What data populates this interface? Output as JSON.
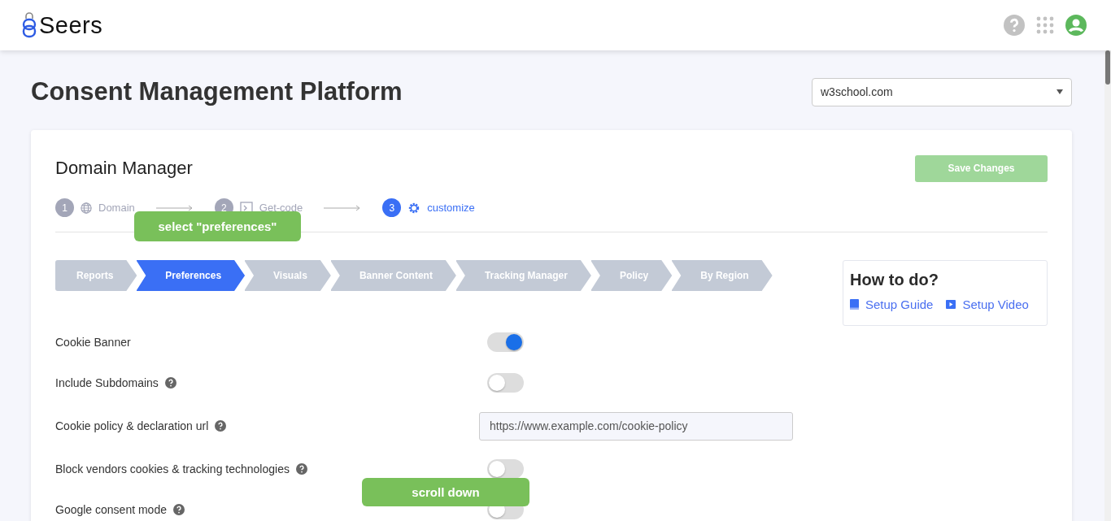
{
  "header": {
    "logo_text": "Seers"
  },
  "page_title": "Consent Management Platform",
  "domain_select": {
    "value": "w3school.com"
  },
  "card": {
    "title": "Domain Manager",
    "save_button": {
      "label": "Save Changes",
      "disabled": true
    },
    "steps": [
      {
        "number": "1",
        "label": "Domain",
        "selected": false
      },
      {
        "number": "2",
        "label": "Get-code",
        "selected": false
      },
      {
        "number": "3",
        "label": "customize",
        "selected": true
      }
    ],
    "tabs": [
      {
        "label": "Reports",
        "selected": false
      },
      {
        "label": "Preferences",
        "selected": true
      },
      {
        "label": "Visuals",
        "selected": false
      },
      {
        "label": "Banner Content",
        "selected": false
      },
      {
        "label": "Tracking Manager",
        "selected": false
      },
      {
        "label": "Policy",
        "selected": false
      },
      {
        "label": "By Region",
        "selected": false
      }
    ],
    "how_to": {
      "title": "How to do?",
      "links": [
        {
          "kind": "guide",
          "label": "Setup Guide"
        },
        {
          "kind": "video",
          "label": "Setup Video"
        }
      ]
    },
    "settings": [
      {
        "kind": "toggle",
        "label": "Cookie Banner",
        "help": false,
        "on": true
      },
      {
        "kind": "toggle",
        "label": "Include Subdomains",
        "help": true,
        "on": false
      },
      {
        "kind": "input",
        "label": "Cookie policy & declaration url",
        "help": true,
        "placeholder": "https://www.example.com/cookie-policy"
      },
      {
        "kind": "toggle",
        "label": "Block vendors cookies & tracking technologies",
        "help": true,
        "on": false
      },
      {
        "kind": "toggle",
        "label": "Google consent mode",
        "help": true,
        "on": false
      }
    ]
  },
  "annotations": [
    {
      "text": "select \"preferences\""
    },
    {
      "text": "scroll down"
    }
  ]
}
